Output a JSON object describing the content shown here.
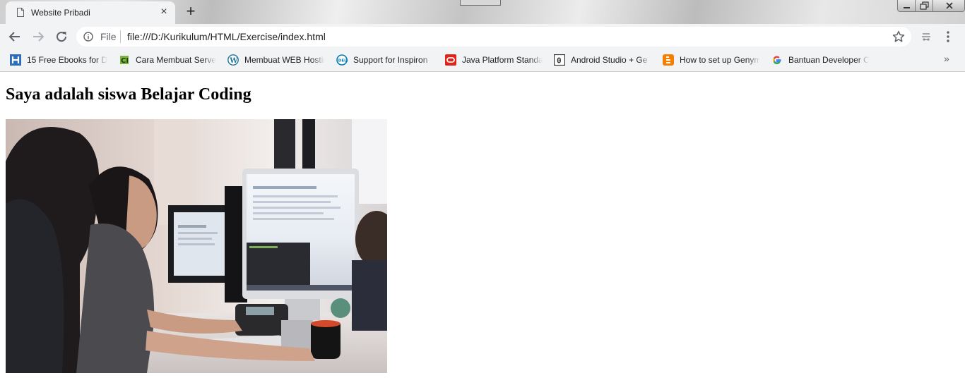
{
  "browser": {
    "tab": {
      "title": "Website Pribadi"
    },
    "address": {
      "scheme": "File",
      "url": "file:///D:/Kurikulum/HTML/Exercise/index.html"
    },
    "icons": {
      "back": "back-arrow-icon",
      "forward": "forward-arrow-icon",
      "reload": "reload-icon",
      "info": "info-icon",
      "star": "star-icon",
      "extension": "extension-icon",
      "menu": "kebab-menu-icon"
    },
    "bookmarks": [
      {
        "label": "15 Free Ebooks for D",
        "icon": "h-favicon",
        "color": "#2a6ebb"
      },
      {
        "label": "Cara Membuat Serve",
        "icon": "ci-favicon",
        "color": "#7cb342"
      },
      {
        "label": "Membuat WEB Hostin",
        "icon": "wordpress-favicon",
        "color": "#21759b"
      },
      {
        "label": "Support for Inspiron",
        "icon": "dell-favicon",
        "color": "#007db8"
      },
      {
        "label": "Java Platform Standa",
        "icon": "oracle-favicon",
        "color": "#e2231a"
      },
      {
        "label": "Android Studio + Ge",
        "icon": "zero-favicon",
        "color": "#333333"
      },
      {
        "label": "How to set up Genym",
        "icon": "blogger-favicon",
        "color": "#f57d00"
      },
      {
        "label": "Bantuan Developer C",
        "icon": "google-favicon",
        "color": "#4285f4"
      }
    ],
    "overflow_label": "»"
  },
  "page": {
    "heading": "Saya adalah siswa Belajar Coding"
  }
}
